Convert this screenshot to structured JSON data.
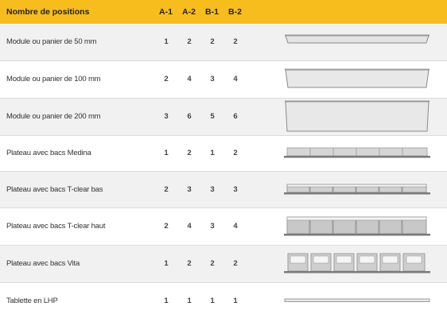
{
  "header": {
    "col_name": "Nombre de positions",
    "col_a1": "A-1",
    "col_a2": "A-2",
    "col_b1": "B-1",
    "col_b2": "B-2"
  },
  "rows": [
    {
      "label": "Module ou panier de 50 mm",
      "a1": "1",
      "a2": "2",
      "b1": "2",
      "b2": "2",
      "icon": "tray-50mm-icon"
    },
    {
      "label": "Module ou panier de 100 mm",
      "a1": "2",
      "a2": "4",
      "b1": "3",
      "b2": "4",
      "icon": "tray-100mm-icon"
    },
    {
      "label": "Module ou panier de 200 mm",
      "a1": "3",
      "a2": "6",
      "b1": "5",
      "b2": "6",
      "icon": "tray-200mm-icon"
    },
    {
      "label": "Plateau avec bacs Medina",
      "a1": "1",
      "a2": "2",
      "b1": "1",
      "b2": "2",
      "icon": "medina-bins-tray-icon"
    },
    {
      "label": "Plateau avec bacs T-clear bas",
      "a1": "2",
      "a2": "3",
      "b1": "3",
      "b2": "3",
      "icon": "tclear-low-bins-tray-icon"
    },
    {
      "label": "Plateau avec bacs T-clear haut",
      "a1": "2",
      "a2": "4",
      "b1": "3",
      "b2": "4",
      "icon": "tclear-high-bins-tray-icon"
    },
    {
      "label": "Plateau avec bacs Vita",
      "a1": "1",
      "a2": "2",
      "b1": "2",
      "b2": "2",
      "icon": "vita-bins-tray-icon"
    },
    {
      "label": "Tablette en LHP",
      "a1": "1",
      "a2": "1",
      "b1": "1",
      "b2": "1",
      "icon": "lhp-shelf-icon"
    }
  ],
  "colors": {
    "header_bg": "#f6bd1c",
    "row_shade": "#f1f1f1",
    "tray_fill": "#e4e4e4",
    "bin_fill": "#c9c9c9",
    "outline": "#8a8a8a"
  }
}
